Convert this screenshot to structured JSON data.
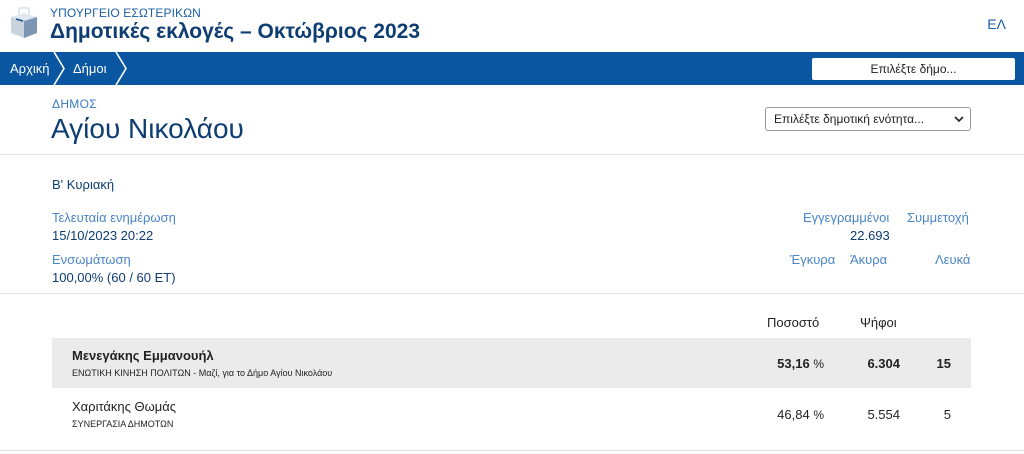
{
  "header": {
    "ministry": "ΥΠΟΥΡΓΕΙΟ ΕΣΩΤΕΡΙΚΩΝ",
    "title": "Δημοτικές εκλογές – Οκτώβριος 2023",
    "language": "ΕΛ",
    "logo_icon": "ballot-box-icon"
  },
  "nav": {
    "home": "Αρχική",
    "municipalities": "Δήμοι",
    "municipality_select": "Επιλέξτε δήμο...",
    "nav_color": "#0a56a0"
  },
  "municipality": {
    "label": "ΔΗΜΟΣ",
    "name": "Αγίου Νικολάου",
    "unit_select_placeholder": "Επιλέξτε δημοτική ενότητα..."
  },
  "round": "Β' Κυριακή",
  "stats": {
    "last_update_label": "Τελευταία ενημέρωση",
    "last_update_value": "15/10/2023 20:22",
    "integration_label": "Ενσωμάτωση",
    "integration_value": "100,00% (60 / 60 ΕΤ)",
    "registered_label": "Εγγεγραμμένοι",
    "registered_value": "22.693",
    "turnout_label": "Συμμετοχή",
    "valid_label": "Έγκυρα",
    "invalid_label": "Άκυρα",
    "blank_label": "Λευκά"
  },
  "results": {
    "columns": {
      "percentage": "Ποσοστό",
      "votes": "Ψήφοι"
    },
    "rows": [
      {
        "candidate": "Μενεγάκης Εμμανουήλ",
        "party": "ΕΝΩΤΙΚΗ ΚΙΝΗΣΗ ΠΟΛΙΤΩΝ - Μαζί, για το Δήμο Αγίου Νικολάου",
        "percentage": "53,16",
        "percent_sign": "%",
        "votes": "6.304",
        "seats": "15"
      },
      {
        "candidate": "Χαριτάκης Θωμάς",
        "party": "ΣΥΝΕΡΓΑΣΙΑ ΔΗΜΟΤΩΝ",
        "percentage": "46,84",
        "percent_sign": "%",
        "votes": "5.554",
        "seats": "5"
      }
    ]
  }
}
